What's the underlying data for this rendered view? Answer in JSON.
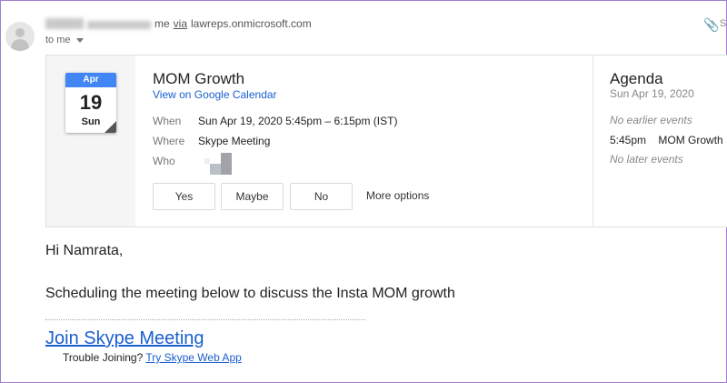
{
  "header": {
    "sender_suffix": "me",
    "via_label": "via",
    "via_domain": "lawreps.onmicrosoft.com",
    "recipient_label": "to me",
    "attach_letter": "S"
  },
  "event": {
    "calendar_month": "Apr",
    "calendar_day": "19",
    "calendar_weekday": "Sun",
    "title": "MOM Growth",
    "calendar_link": "View on Google Calendar",
    "when_label": "When",
    "when_value": "Sun Apr 19, 2020 5:45pm – 6:15pm (IST)",
    "where_label": "Where",
    "where_value": "Skype Meeting",
    "who_label": "Who",
    "rsvp": {
      "yes": "Yes",
      "maybe": "Maybe",
      "no": "No",
      "more": "More options"
    }
  },
  "agenda": {
    "title": "Agenda",
    "date": "Sun Apr 19, 2020",
    "no_earlier": "No earlier events",
    "event_time": "5:45pm",
    "event_name": "MOM Growth",
    "no_later": "No later events"
  },
  "body": {
    "greeting": "Hi Namrata,",
    "message": "Scheduling the meeting below to discuss the Insta MOM growth",
    "join_link": "Join Skype Meeting",
    "trouble_text": "Trouble Joining?",
    "web_app_link": "Try Skype Web App"
  },
  "colors": {
    "link": "#1a5fcf",
    "calendar_header": "#4285f4",
    "frame_border": "#9e7fcf"
  }
}
